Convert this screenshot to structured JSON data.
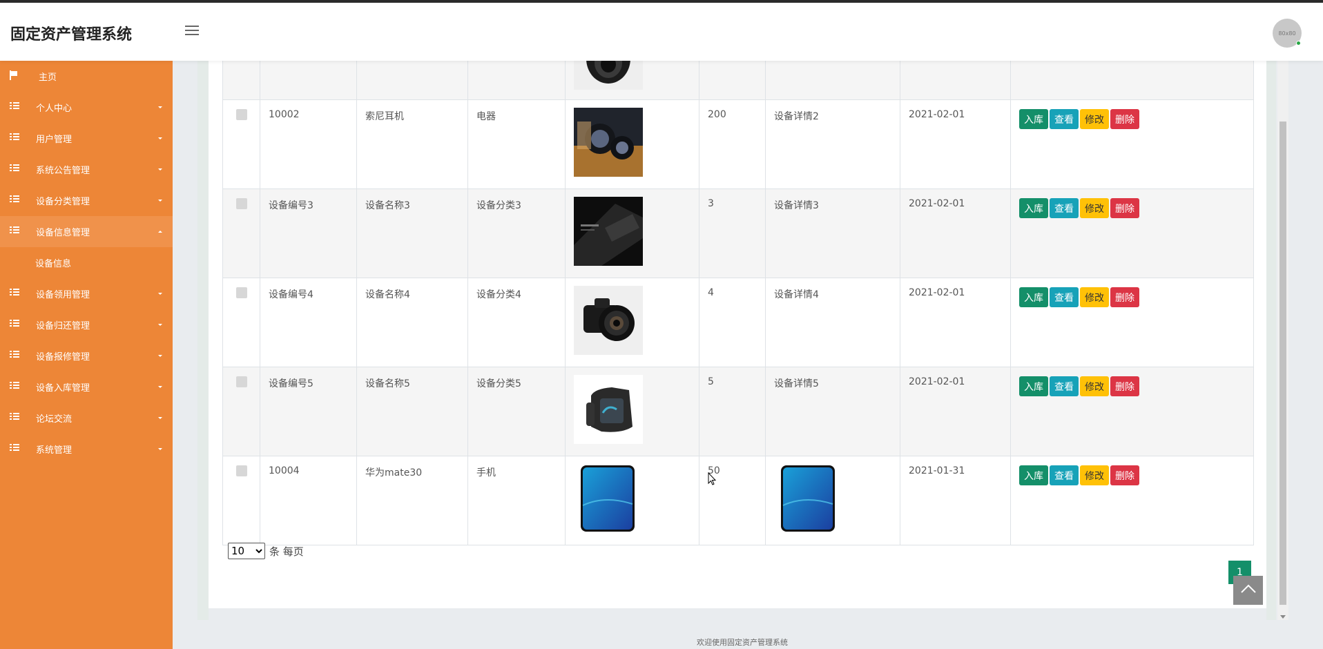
{
  "header": {
    "app_title": "固定资产管理系统",
    "avatar_text": "80x80"
  },
  "sidebar": {
    "home": "主页",
    "items": [
      {
        "label": "个人中心"
      },
      {
        "label": "用户管理"
      },
      {
        "label": "系统公告管理"
      },
      {
        "label": "设备分类管理"
      },
      {
        "label": "设备信息管理",
        "expanded": true,
        "children": [
          "设备信息"
        ]
      },
      {
        "label": "设备领用管理"
      },
      {
        "label": "设备归还管理"
      },
      {
        "label": "设备报修管理"
      },
      {
        "label": "设备入库管理"
      },
      {
        "label": "论坛交流"
      },
      {
        "label": "系统管理"
      }
    ]
  },
  "table": {
    "rows": [
      {
        "code": "10002",
        "name": "索尼耳机",
        "category": "电器",
        "image": "earphones-photo",
        "quantity": "200",
        "detail": "设备详情2",
        "date": "2021-02-01"
      },
      {
        "code": "设备编号3",
        "name": "设备名称3",
        "category": "设备分类3",
        "image": "phone-dark-photo",
        "quantity": "3",
        "detail": "设备详情3",
        "date": "2021-02-01"
      },
      {
        "code": "设备编号4",
        "name": "设备名称4",
        "category": "设备分类4",
        "image": "camera-photo",
        "quantity": "4",
        "detail": "设备详情4",
        "date": "2021-02-01"
      },
      {
        "code": "设备编号5",
        "name": "设备名称5",
        "category": "设备分类5",
        "image": "smartwatch-photo",
        "quantity": "5",
        "detail": "设备详情5",
        "date": "2021-02-01"
      },
      {
        "code": "10004",
        "name": "华为mate30",
        "category": "手机",
        "image": "huawei-phone-photo",
        "quantity": "50",
        "detail": "",
        "detail_image": "huawei-phone-photo",
        "date": "2021-01-31"
      }
    ],
    "actions": {
      "in": "入库",
      "view": "查看",
      "edit": "修改",
      "delete": "删除"
    }
  },
  "pagination": {
    "page_size": "10",
    "page_size_options": [
      "10"
    ],
    "suffix": "条 每页",
    "current_page": "1"
  },
  "footer": {
    "text": "欢迎使用固定资产管理系统"
  },
  "colors": {
    "sidebar": "#ed8637",
    "primary_green": "#148f69",
    "info": "#17a2b8",
    "warning": "#ffc107",
    "danger": "#dc3545"
  }
}
